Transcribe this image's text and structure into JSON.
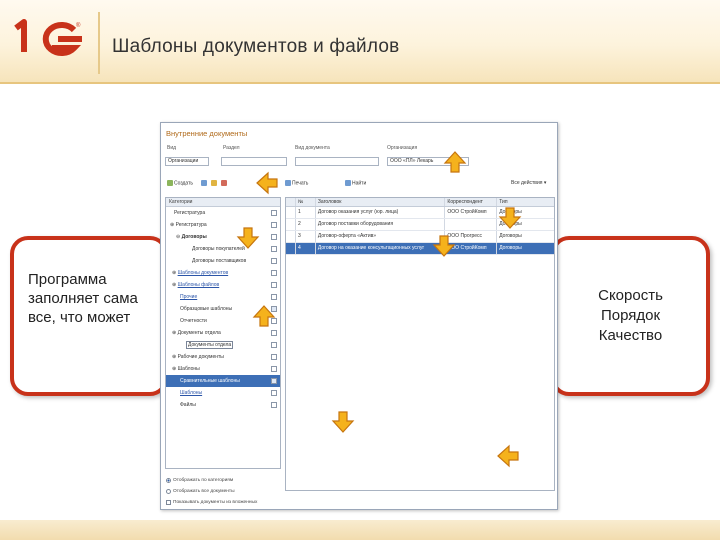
{
  "slide": {
    "title": "Шаблоны документов и файлов"
  },
  "colors": {
    "accent": "#c8321a",
    "arrow_fill": "#f5b21c",
    "arrow_stroke": "#c6750f",
    "selection": "#3d6fb6"
  },
  "callout_left": {
    "text": "Программа заполняет сама все, что может"
  },
  "callout_right": {
    "lines": [
      "Скорость",
      "Порядок",
      "Качество"
    ]
  },
  "screenshot": {
    "title": "Внутренние документы",
    "filters": {
      "label_1": "Вид",
      "label_2": "Раздел",
      "label_3": "Вид документа",
      "label_4": "Организация",
      "value_1": "Организации",
      "value_2": "",
      "value_3": "",
      "value_4": "ООО «ПЛ» Лекарь"
    },
    "toolbar": {
      "create": "Создать",
      "print": "Печать",
      "search": "Найти",
      "more": "Все действия"
    },
    "tree": {
      "header": "Категории",
      "items": [
        "Регистратура",
        "Регистратура",
        "Договоры",
        "Договоры покупателей",
        "Договоры поставщиков",
        "Шаблоны документов",
        "Шаблоны файлов",
        "Прочие",
        "Образцовые шаблоны",
        "Отчетности",
        "Документы отдела",
        "Документы отдела",
        "Рабочие документы",
        "Шаблоны",
        "Сравнительные шаблоны",
        "Шаблоны",
        "Файлы"
      ]
    },
    "grid": {
      "headers": [
        "",
        "№",
        "Заголовок",
        "Корреспондент",
        "Тип"
      ],
      "rows": [
        [
          "",
          "1",
          "Договор оказания услуг (юр. лица)",
          "ООО СтройКомп",
          "Договоры"
        ],
        [
          "",
          "2",
          "Договор поставки оборудования",
          "",
          "Договоры"
        ],
        [
          "",
          "3",
          "Договор-оферта «Актив»",
          "ООО Прогресс",
          "Договоры"
        ],
        [
          "",
          "4",
          "Договор на оказание консультационных услуг",
          "ООО СтройКомп",
          "Договоры"
        ]
      ]
    },
    "bottom_options": [
      "Отображать по категориям",
      "Отображать все документы",
      "Показывать документы из вложенных"
    ]
  }
}
